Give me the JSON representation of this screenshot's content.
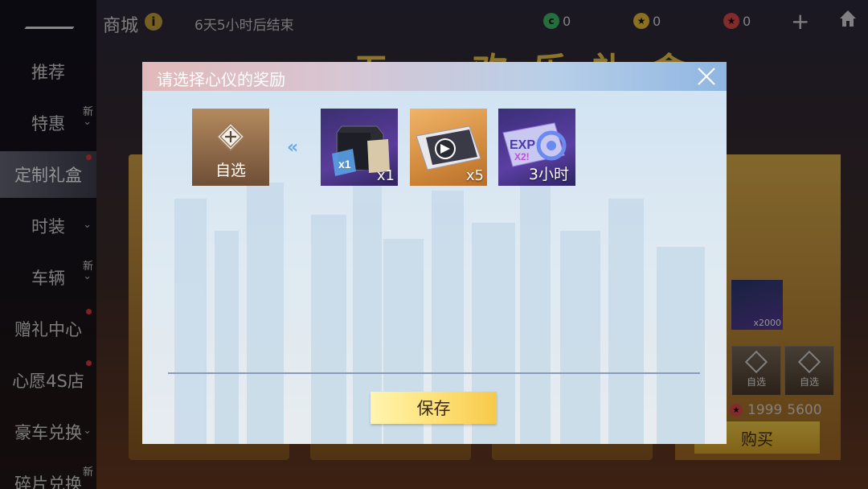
{
  "sidebar": {
    "items": [
      {
        "label": "推荐",
        "badge": "",
        "chevron": false,
        "dot": false,
        "active": false
      },
      {
        "label": "特惠",
        "badge": "新",
        "chevron": true,
        "dot": false,
        "active": false
      },
      {
        "label": "定制礼盒",
        "badge": "",
        "chevron": false,
        "dot": true,
        "active": true
      },
      {
        "label": "时装",
        "badge": "",
        "chevron": true,
        "dot": false,
        "active": false
      },
      {
        "label": "车辆",
        "badge": "新",
        "chevron": true,
        "dot": false,
        "active": false
      },
      {
        "label": "赠礼中心",
        "badge": "",
        "chevron": false,
        "dot": true,
        "active": false
      },
      {
        "label": "心愿4S店",
        "badge": "",
        "chevron": false,
        "dot": true,
        "active": false
      },
      {
        "label": "豪车兑换",
        "badge": "",
        "chevron": true,
        "dot": false,
        "active": false
      },
      {
        "label": "碎片兑换",
        "badge": "新",
        "chevron": true,
        "dot": false,
        "active": false
      }
    ]
  },
  "topbar": {
    "title": "商城",
    "info_icon": "i",
    "timer": "6天5小时后结束",
    "currencies": [
      {
        "icon": "coupon-icon",
        "value": "0",
        "color": "#3fbf6a"
      },
      {
        "icon": "star-coin-icon",
        "value": "0",
        "color": "#f0c23a"
      },
      {
        "icon": "gem-coin-icon",
        "value": "0",
        "color": "#e24a4a"
      }
    ],
    "plus": "+"
  },
  "background": {
    "banner": "五一欢乐礼盒",
    "right_card": {
      "slots": [
        "自选",
        "自选"
      ],
      "price_old": "1999",
      "price_new": "5600",
      "buy_label": "购买",
      "reward_qty": "x2000"
    }
  },
  "dialog": {
    "title": "请选择心仪的奖励",
    "custom_slot_label": "自选",
    "arrow": "«",
    "items": [
      {
        "name": "gift-box",
        "qty": "x1"
      },
      {
        "name": "racing-ticket",
        "qty": "x5"
      },
      {
        "name": "exp-card",
        "qty": "3小时"
      }
    ],
    "save_label": "保存"
  },
  "colors": {
    "accent_gold": "#f7c949",
    "header_left": "#e2b9b9",
    "header_right": "#8fb6e2",
    "arrow_blue": "#6aa8e8"
  }
}
